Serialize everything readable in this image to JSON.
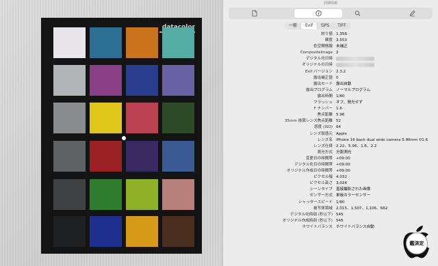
{
  "photo": {
    "brand": "datacolor",
    "patches": [
      [
        "#e8e6ea",
        "#2d6f94",
        "#c7741d",
        "#56ada4"
      ],
      [
        "#b2b4b8",
        "#8b3f86",
        "#2a3d8e",
        "#6960a6"
      ],
      [
        "#8a8c8e",
        "#e1c71a",
        "#b8424f",
        "#2e4b28"
      ],
      [
        "#5f6163",
        "#9c1f24",
        "#3a2a62",
        "#3a5b94"
      ],
      [
        "#3f4143",
        "#2f7d2f",
        "#8fb127",
        "#b8807a"
      ],
      [
        "#1f2022",
        "#1f2f90",
        "#d79a19",
        "#4a2f1f"
      ]
    ]
  },
  "window": {
    "title": "詳細情報",
    "toolbar": {
      "icons": [
        "document-icon",
        "info-icon",
        "search-icon",
        "pencil-icon"
      ]
    },
    "segments": [
      {
        "label": "一般",
        "active": false
      },
      {
        "label": "Exif",
        "active": true
      },
      {
        "label": "GPS",
        "active": false
      },
      {
        "label": "TIFF",
        "active": false
      }
    ],
    "rows": [
      {
        "label": "絞り値",
        "value": "1.356"
      },
      {
        "label": "輝度",
        "value": "3.553"
      },
      {
        "label": "色空間情報",
        "value": "未補正"
      },
      {
        "label": "CompositeImage",
        "value": "2"
      },
      {
        "label": "デジタル化日時",
        "value": "",
        "blurred": true
      },
      {
        "label": "オリジナルの日時",
        "value": "",
        "blurred": true
      },
      {
        "label": "Exif バージョン",
        "value": "2.3.2"
      },
      {
        "label": "露出補正値",
        "value": "0"
      },
      {
        "label": "露出モード",
        "value": "露出自動"
      },
      {
        "label": "露出プログラム",
        "value": "ノーマルプログラム"
      },
      {
        "label": "露出時間",
        "value": "1/60"
      },
      {
        "label": "フラッシュ",
        "value": "オフ、発光せず"
      },
      {
        "label": "F ナンバー",
        "value": "1.6"
      },
      {
        "label": "焦点距離",
        "value": "5.96"
      },
      {
        "label": "35mm 換算レンズ焦点距離",
        "value": "52"
      },
      {
        "label": "感度 (ISO)",
        "value": "64"
      },
      {
        "label": "レンズ製造元",
        "value": "Apple"
      },
      {
        "label": "レンズ名",
        "value": "iPhone 16 back dual wide camera 5.96mm f/1.6"
      },
      {
        "label": "レンズ仕様",
        "value": "2.22、5.96、1.6、2.2"
      },
      {
        "label": "測光方式",
        "value": "分割測光"
      },
      {
        "label": "変更日の時間帯",
        "value": "+09:00"
      },
      {
        "label": "デジタル化日の時間帯",
        "value": "+09:00"
      },
      {
        "label": "オリジナル作成日の時間帯",
        "value": "+09:00"
      },
      {
        "label": "ピクセル幅",
        "value": "4,032"
      },
      {
        "label": "ピクセル高さ",
        "value": "3,024"
      },
      {
        "label": "シーンタイプ",
        "value": "直接撮影された画像"
      },
      {
        "label": "センサー方式",
        "value": "単板カラーセンサー"
      },
      {
        "label": "シャッタースピード",
        "value": "1/60"
      },
      {
        "label": "被写体領域",
        "value": "2,015、1,507、1,106、662"
      },
      {
        "label": "デジタル化時刻 (秒以下)",
        "value": "545"
      },
      {
        "label": "オリジナル作成時刻 (秒以下)",
        "value": "545"
      },
      {
        "label": "ホワイトバランス",
        "value": "ホワイトバランス自動"
      }
    ]
  },
  "badge": {
    "text": "鑑済定"
  }
}
